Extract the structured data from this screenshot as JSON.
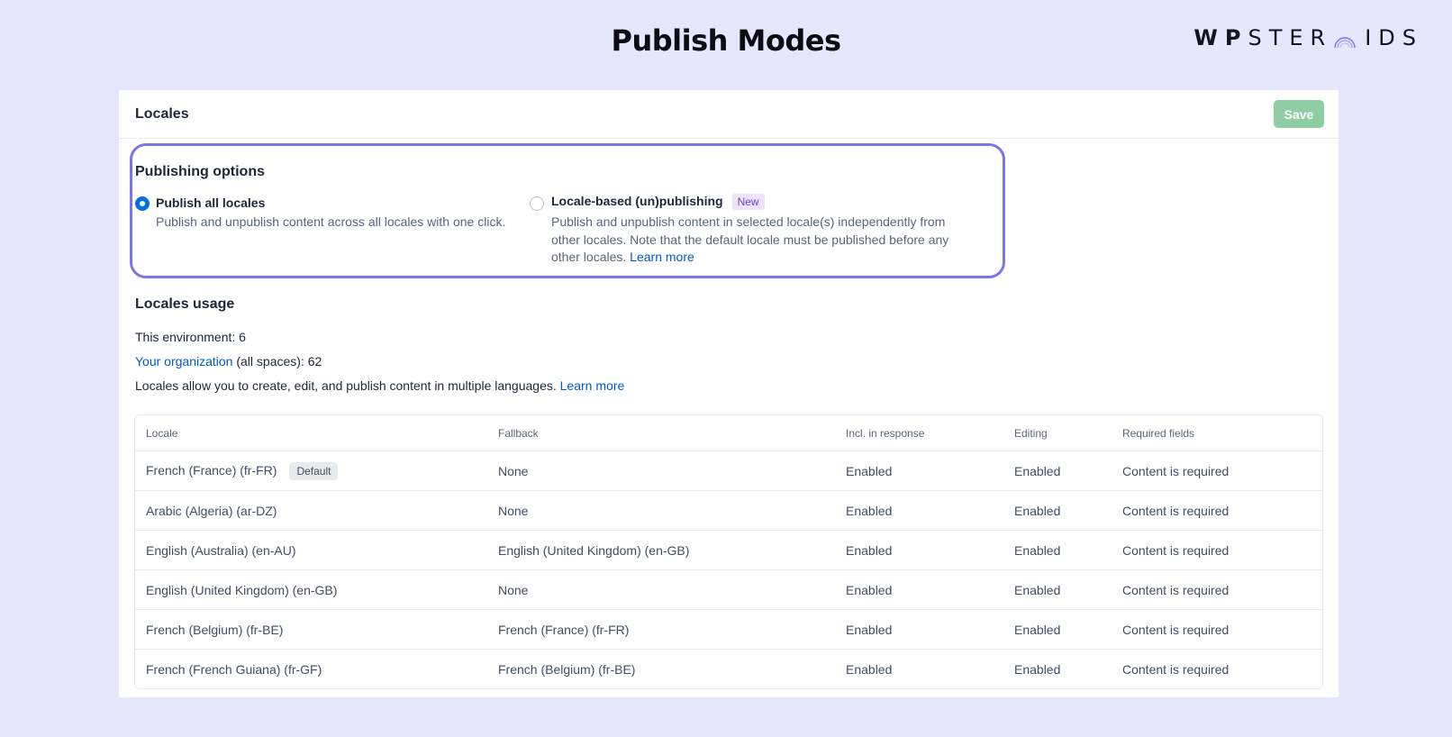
{
  "page_title": "Publish Modes",
  "logo": {
    "part1": "WP",
    "part2": "STER",
    "part3": "IDS"
  },
  "card": {
    "title": "Locales",
    "save_label": "Save"
  },
  "publishing": {
    "title": "Publishing options",
    "option_all": {
      "label": "Publish all locales",
      "desc": "Publish and unpublish content across all locales with one click.",
      "selected": true
    },
    "option_locale": {
      "label": "Locale-based (un)publishing",
      "badge": "New",
      "desc": "Publish and unpublish content in selected locale(s) independently from other locales. Note that the default locale must be published before any other locales.",
      "link": "Learn more",
      "selected": false
    }
  },
  "usage": {
    "title": "Locales usage",
    "environment": "This environment: 6",
    "org_link": "Your organization",
    "org_rest": " (all spaces): 62",
    "desc": "Locales allow you to create, edit, and publish content in multiple languages. ",
    "learn_more": "Learn more"
  },
  "table": {
    "headers": {
      "locale": "Locale",
      "fallback": "Fallback",
      "incl": "Incl. in response",
      "editing": "Editing",
      "required": "Required fields"
    },
    "rows": [
      {
        "locale": "French (France) (fr-FR)",
        "badge": "Default",
        "fallback": "None",
        "incl": "Enabled",
        "editing": "Enabled",
        "required": "Content is required"
      },
      {
        "locale": "Arabic (Algeria) (ar-DZ)",
        "fallback": "None",
        "incl": "Enabled",
        "editing": "Enabled",
        "required": "Content is required"
      },
      {
        "locale": "English (Australia) (en-AU)",
        "fallback": "English (United Kingdom) (en-GB)",
        "incl": "Enabled",
        "editing": "Enabled",
        "required": "Content is required"
      },
      {
        "locale": "English (United Kingdom) (en-GB)",
        "fallback": "None",
        "incl": "Enabled",
        "editing": "Enabled",
        "required": "Content is required"
      },
      {
        "locale": "French (Belgium) (fr-BE)",
        "fallback": "French (France) (fr-FR)",
        "incl": "Enabled",
        "editing": "Enabled",
        "required": "Content is required"
      },
      {
        "locale": "French (French Guiana) (fr-GF)",
        "fallback": "French (Belgium) (fr-BE)",
        "incl": "Enabled",
        "editing": "Enabled",
        "required": "Content is required"
      }
    ]
  },
  "colors": {
    "background": "#e6e6fd",
    "highlight_border": "#7a75eb",
    "save_button": "#8fcea4",
    "link": "#0059c8",
    "radio_selected": "#036fe3"
  }
}
